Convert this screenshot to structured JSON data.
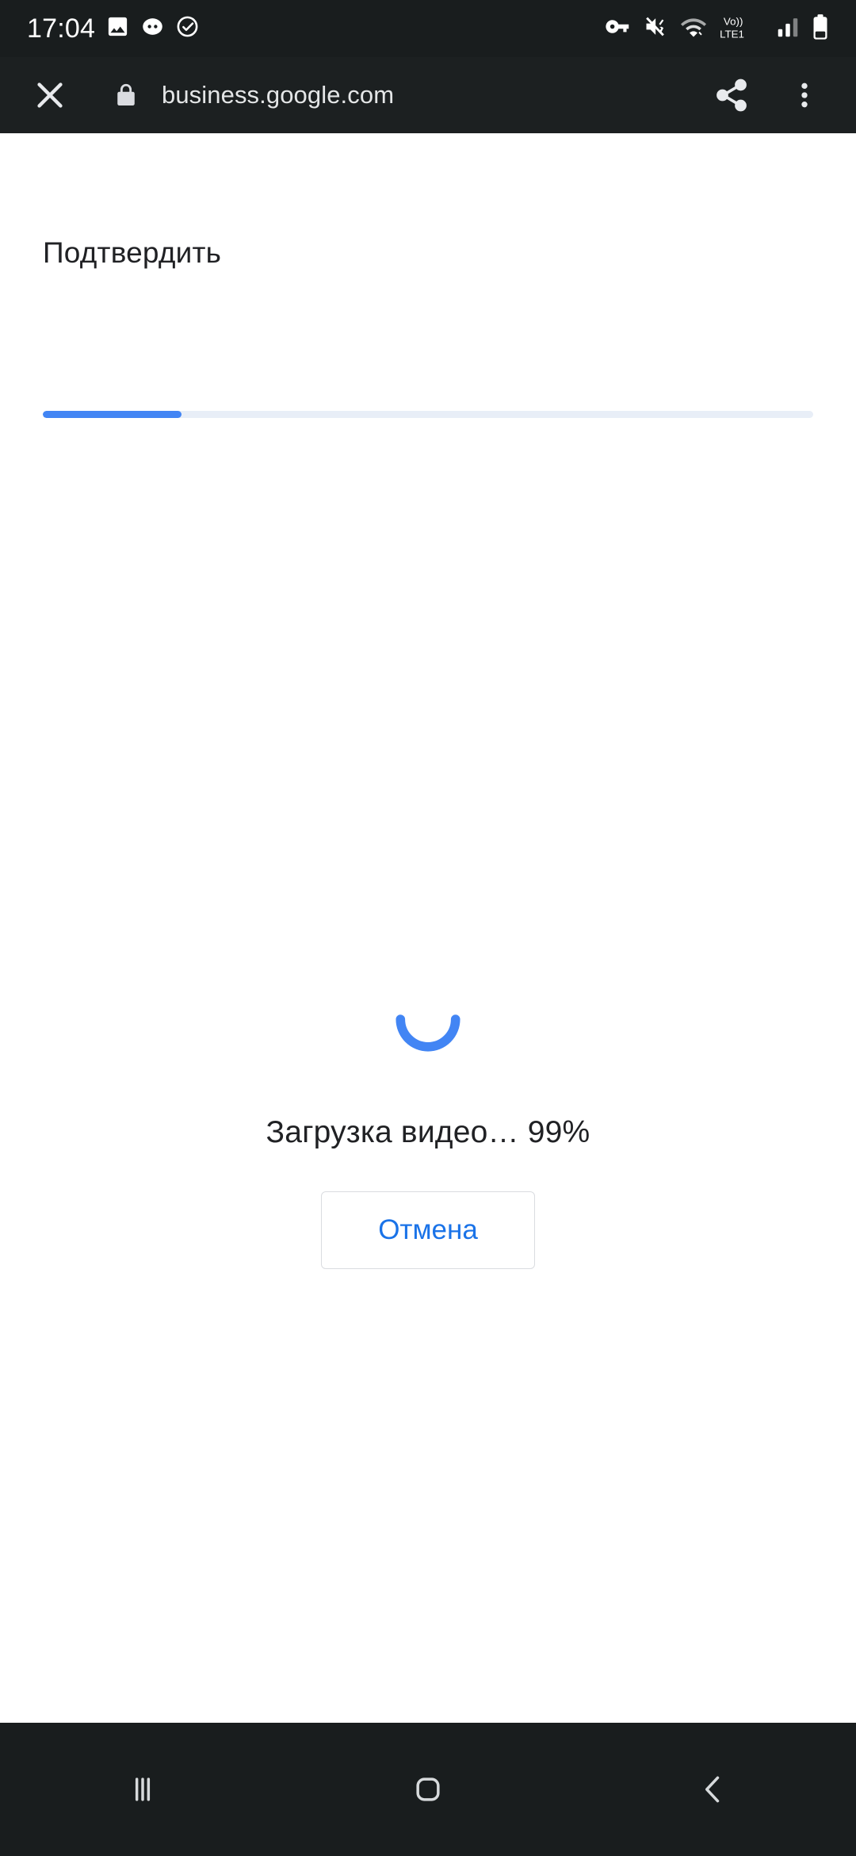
{
  "status_bar": {
    "time": "17:04",
    "left_icons": [
      "image-icon",
      "messaging-icon",
      "check-circle-icon"
    ],
    "right_icons": [
      "vpn-key-icon",
      "mute-vibrate-icon",
      "wifi-icon",
      "volte-lte1-icon",
      "signal-bars-icon",
      "battery-icon"
    ],
    "network_label": "Vo))",
    "network_type": "LTE1",
    "background_color": "#191d1e"
  },
  "browser": {
    "close_label": "close-icon",
    "lock_label": "lock-icon",
    "url": "business.google.com",
    "share_label": "share-icon",
    "menu_label": "more-options-icon",
    "background_color": "#1c2021"
  },
  "page": {
    "step_title": "Подтвердить",
    "progress_percent": 18,
    "progress_color": "#4285f4",
    "progress_track_color": "#e8eef7"
  },
  "loader": {
    "spinner_color": "#4285f4",
    "loading_text": "Загрузка видео… 99%",
    "cancel_label": "Отмена",
    "cancel_text_color": "#1a73e8"
  },
  "nav_bar": {
    "recents_label": "recents-icon",
    "home_label": "home-icon",
    "back_label": "back-icon",
    "background_color": "#191d1e"
  }
}
